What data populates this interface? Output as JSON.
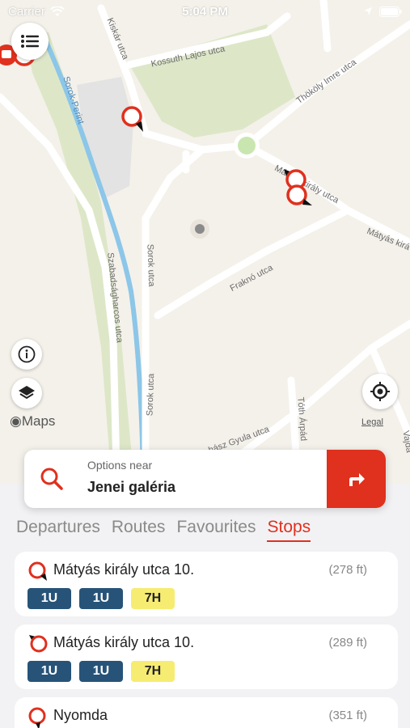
{
  "status_bar": {
    "carrier": "Carrier",
    "time": "5:04 PM"
  },
  "map": {
    "brand": "Maps",
    "legal": "Legal",
    "streets": [
      "Kiskár utca",
      "Kossuth Lajos utca",
      "Thököly Imre utca",
      "Sorok-Perint",
      "Mátyás király utca",
      "Mátyás kirá",
      "Sorok utca",
      "Fraknó utca",
      "Szabadságharcos utca",
      "Sorok utca",
      "Tóth Árpád",
      "hász Gyula utca",
      "Vajda"
    ]
  },
  "search": {
    "label": "Options near",
    "value": "Jenei galéria"
  },
  "tabs": [
    {
      "label": "Departures",
      "active": false
    },
    {
      "label": "Routes",
      "active": false
    },
    {
      "label": "Favourites",
      "active": false
    },
    {
      "label": "Stops",
      "active": true
    }
  ],
  "stops": [
    {
      "name": "Mátyás király utca 10.",
      "distance": "(278 ft)",
      "lines": [
        {
          "label": "1U",
          "color": "#275378"
        },
        {
          "label": "1U",
          "color": "#275378"
        },
        {
          "label": "7H",
          "color": "#f6ec72"
        }
      ]
    },
    {
      "name": "Mátyás király utca 10.",
      "distance": "(289 ft)",
      "lines": [
        {
          "label": "1U",
          "color": "#275378"
        },
        {
          "label": "1U",
          "color": "#275378"
        },
        {
          "label": "7H",
          "color": "#f6ec72"
        }
      ]
    },
    {
      "name": "Nyomda",
      "distance": "(351 ft)",
      "lines": []
    }
  ],
  "colors": {
    "accent": "#e0301e",
    "line_blue": "#275378",
    "line_yellow": "#f6ec72"
  },
  "icons": [
    "wifi-icon",
    "location-arrow-icon",
    "battery-icon",
    "list-icon",
    "info-icon",
    "layers-icon",
    "apple-icon",
    "locate-icon",
    "search-icon",
    "directions-icon",
    "stop-pin-icon"
  ]
}
